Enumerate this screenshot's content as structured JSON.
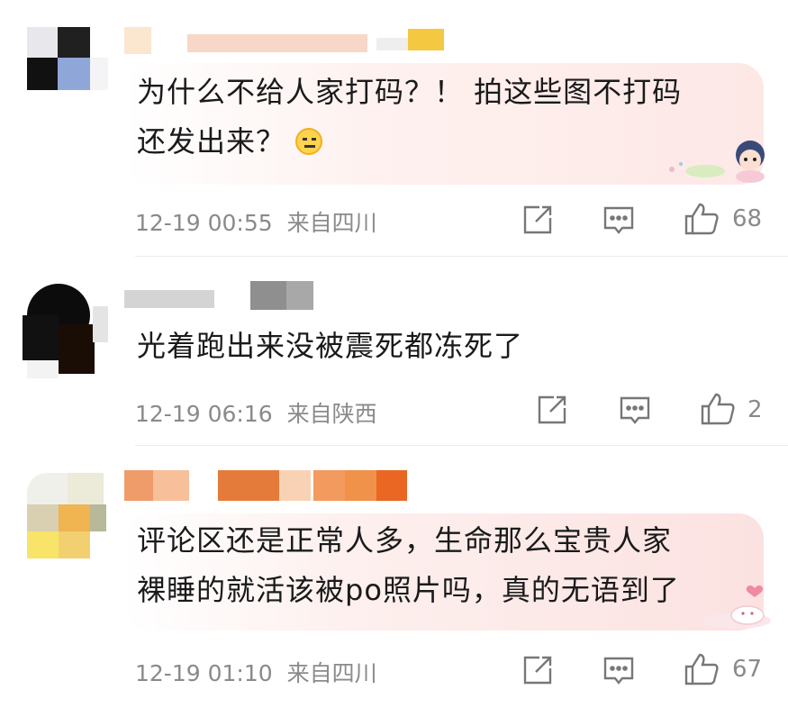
{
  "comments": [
    {
      "text_lines": [
        "为什么不给人家打码？！ 拍这些图不打码",
        "还发出来？"
      ],
      "time": "12-19 00:55",
      "location": "来自四川",
      "likes": "68"
    },
    {
      "text_lines": [
        "光着跑出来没被震死都冻死了"
      ],
      "time": "12-19 06:16",
      "location": "来自陕西",
      "likes": "2"
    },
    {
      "text_lines": [
        "评论区还是正常人多，生命那么宝贵人家",
        "裸睡的就活该被po照片吗，真的无语到了"
      ],
      "time": "12-19 01:10",
      "location": "来自四川",
      "likes": "67"
    }
  ],
  "icons": {
    "share": "share-icon",
    "comment": "comment-icon",
    "like": "thumbs-up-icon",
    "emoji": "emoji-face-icon"
  },
  "colors": {
    "bubble_pink": "#fdecea",
    "bubble_pink_2": "#fde9e6",
    "meta_gray": "#8a8a8a",
    "text": "#1a1a1a"
  }
}
